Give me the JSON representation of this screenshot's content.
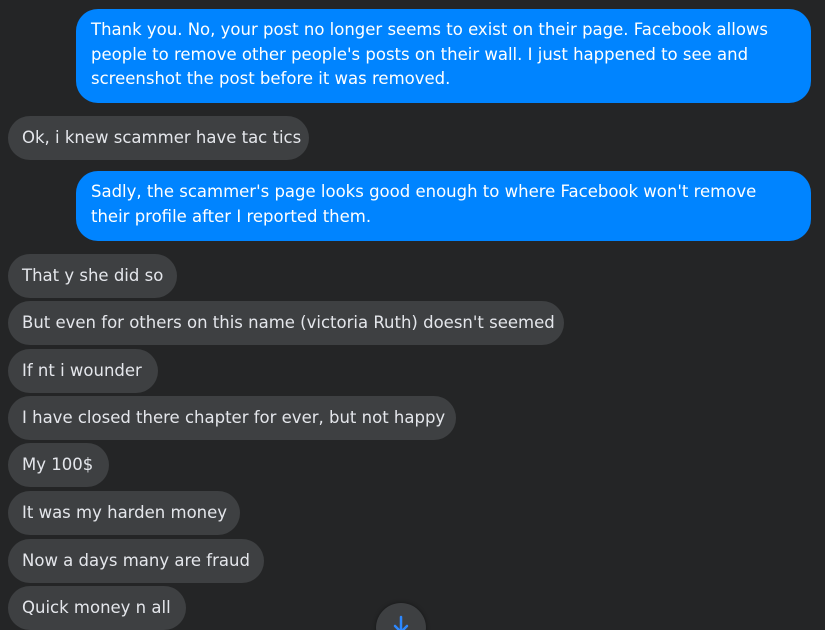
{
  "messages": [
    {
      "from": "me",
      "text": "Thank you. No, your post no longer seems to exist on their page. Facebook allows people to remove other people's posts on their wall. I just happened to see and screenshot the post before it was removed."
    },
    {
      "from": "them",
      "text": "Ok, i knew scammer have tac tics"
    },
    {
      "from": "me",
      "text": "Sadly, the scammer's page looks good enough to where Facebook won't remove their profile after I reported them."
    },
    {
      "from": "them",
      "text": "That y she did so"
    },
    {
      "from": "them",
      "text": "But even for others on this name (victoria Ruth) doesn't seemed"
    },
    {
      "from": "them",
      "text": "If nt i wounder"
    },
    {
      "from": "them",
      "text": "I have closed there chapter for ever, but not happy"
    },
    {
      "from": "them",
      "text": "My 100$"
    },
    {
      "from": "them",
      "text": "It was my harden money"
    },
    {
      "from": "them",
      "text": "Now a days many are fraud"
    },
    {
      "from": "them",
      "text": "Quick money n all"
    }
  ],
  "colors": {
    "background": "#242526",
    "outgoing_bubble": "#0084ff",
    "incoming_bubble": "#3e4042",
    "incoming_text": "#e4e6eb",
    "scroll_arrow": "#2d88ff"
  },
  "icons": {
    "scroll_down": "arrow-down-icon"
  }
}
